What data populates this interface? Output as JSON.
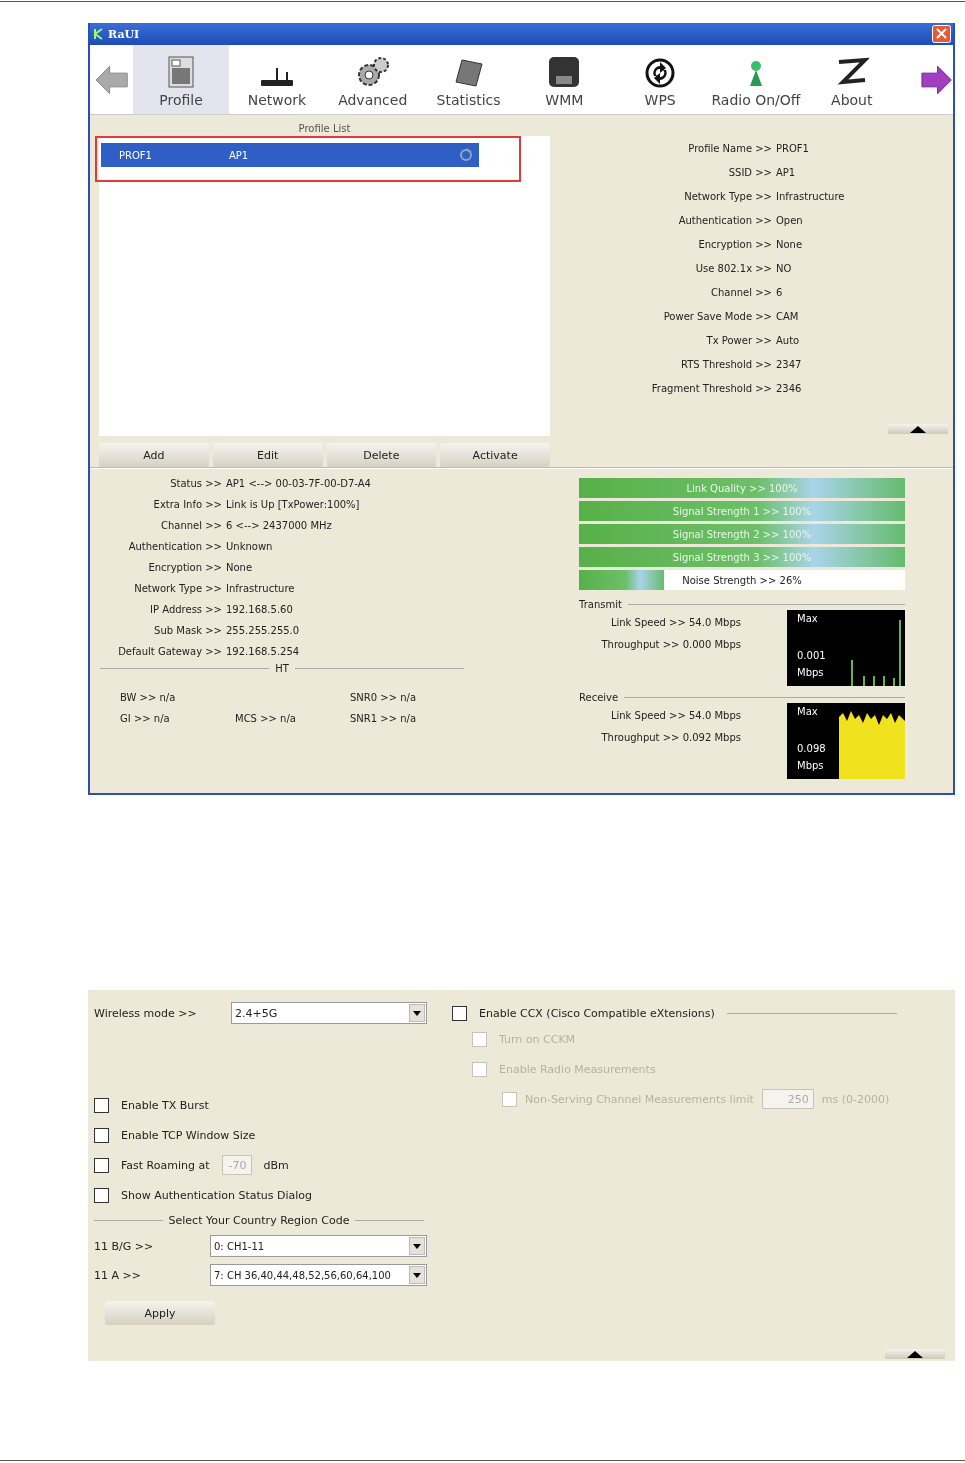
{
  "main_window": {
    "title": "RaUI",
    "toolbar": [
      {
        "label": "Profile",
        "selected": true
      },
      {
        "label": "Network",
        "selected": false
      },
      {
        "label": "Advanced",
        "selected": false
      },
      {
        "label": "Statistics",
        "selected": false
      },
      {
        "label": "WMM",
        "selected": false
      },
      {
        "label": "WPS",
        "selected": false
      },
      {
        "label": "Radio On/Off",
        "selected": false
      },
      {
        "label": "About",
        "selected": false
      }
    ],
    "profile_list": {
      "title": "Profile List",
      "profiles": [
        {
          "name": "PROF1",
          "ssid": "AP1",
          "selected": true,
          "highlighted": true
        }
      ],
      "buttons": [
        "Add",
        "Edit",
        "Delete",
        "Activate"
      ]
    },
    "profile_details": [
      {
        "label": "Profile Name >>",
        "value": "PROF1"
      },
      {
        "label": "SSID >>",
        "value": "AP1"
      },
      {
        "label": "Network Type >>",
        "value": "Infrastructure"
      },
      {
        "label": "Authentication >>",
        "value": "Open"
      },
      {
        "label": "Encryption >>",
        "value": "None"
      },
      {
        "label": "Use 802.1x >>",
        "value": "NO"
      },
      {
        "label": "Channel >>",
        "value": "6"
      },
      {
        "label": "Power Save Mode >>",
        "value": "CAM"
      },
      {
        "label": "Tx Power >>",
        "value": "Auto"
      },
      {
        "label": "RTS Threshold >>",
        "value": "2347"
      },
      {
        "label": "Fragment Threshold >>",
        "value": "2346"
      }
    ],
    "status": [
      {
        "label": "Status >>",
        "value": "AP1 <--> 00-03-7F-00-D7-A4"
      },
      {
        "label": "Extra Info >>",
        "value": "Link is Up [TxPower:100%]"
      },
      {
        "label": "Channel >>",
        "value": "6 <--> 2437000 MHz"
      },
      {
        "label": "Authentication >>",
        "value": "Unknown"
      },
      {
        "label": "Encryption >>",
        "value": "None"
      },
      {
        "label": "Network Type >>",
        "value": "Infrastructure"
      },
      {
        "label": "IP Address >>",
        "value": "192.168.5.60"
      },
      {
        "label": "Sub Mask >>",
        "value": "255.255.255.0"
      },
      {
        "label": "Default Gateway >>",
        "value": "192.168.5.254"
      }
    ],
    "ht": {
      "title": "HT",
      "rows": [
        [
          "BW >> n/a",
          "",
          "SNR0 >> n/a"
        ],
        [
          "GI >> n/a",
          "MCS >> n/a",
          "SNR1 >> n/a"
        ]
      ]
    },
    "meters": [
      {
        "label": "Link Quality >> 100%",
        "level": 1
      },
      {
        "label": "Signal Strength 1 >> 100%",
        "level": 1
      },
      {
        "label": "Signal Strength 2 >> 100%",
        "level": 1
      },
      {
        "label": "Signal Strength 3 >> 100%",
        "level": 1
      },
      {
        "label": "Noise Strength >> 26%",
        "level": 0.26
      }
    ],
    "traffic": [
      {
        "title": "Transmit",
        "kind": "transmit",
        "link_speed": "Link Speed >> 54.0 Mbps",
        "throughput": "Throughput >> 0.000 Mbps",
        "graph_max": "Max",
        "graph_value": "0.001",
        "graph_unit": "Mbps"
      },
      {
        "title": "Receive",
        "kind": "receive",
        "link_speed": "Link Speed >> 54.0 Mbps",
        "throughput": "Throughput >> 0.092 Mbps",
        "graph_max": "Max",
        "graph_value": "0.098",
        "graph_unit": "Mbps"
      }
    ]
  },
  "advanced_window": {
    "wireless_mode": {
      "label": "Wireless mode >>",
      "value": "2.4+5G"
    },
    "options": [
      {
        "label": "Enable TX Burst",
        "checked": false
      },
      {
        "label": "Enable TCP Window Size",
        "checked": false
      },
      {
        "label": "Fast Roaming at",
        "checked": false,
        "field": "-70",
        "unit": "dBm"
      },
      {
        "label": "Show Authentication Status Dialog",
        "checked": false
      }
    ],
    "region": {
      "title": "Select Your Country Region Code",
      "rows": [
        {
          "label": "11 B/G >>",
          "value": "0: CH1-11"
        },
        {
          "label": "11 A >>",
          "value": "7: CH 36,40,44,48,52,56,60,64,100"
        }
      ]
    },
    "apply": "Apply",
    "ccx": {
      "label": "Enable CCX (Cisco Compatible eXtensions)",
      "checked": false,
      "sub": [
        {
          "label": "Turn on CCKM",
          "checked": false,
          "disabled": true
        },
        {
          "label": "Enable Radio Measurements",
          "checked": false,
          "disabled": true
        }
      ],
      "limit": {
        "label": "Non-Serving Channel Measurements limit",
        "checked": false,
        "disabled": true,
        "field": "250",
        "unit": "ms (0-2000)"
      }
    }
  }
}
